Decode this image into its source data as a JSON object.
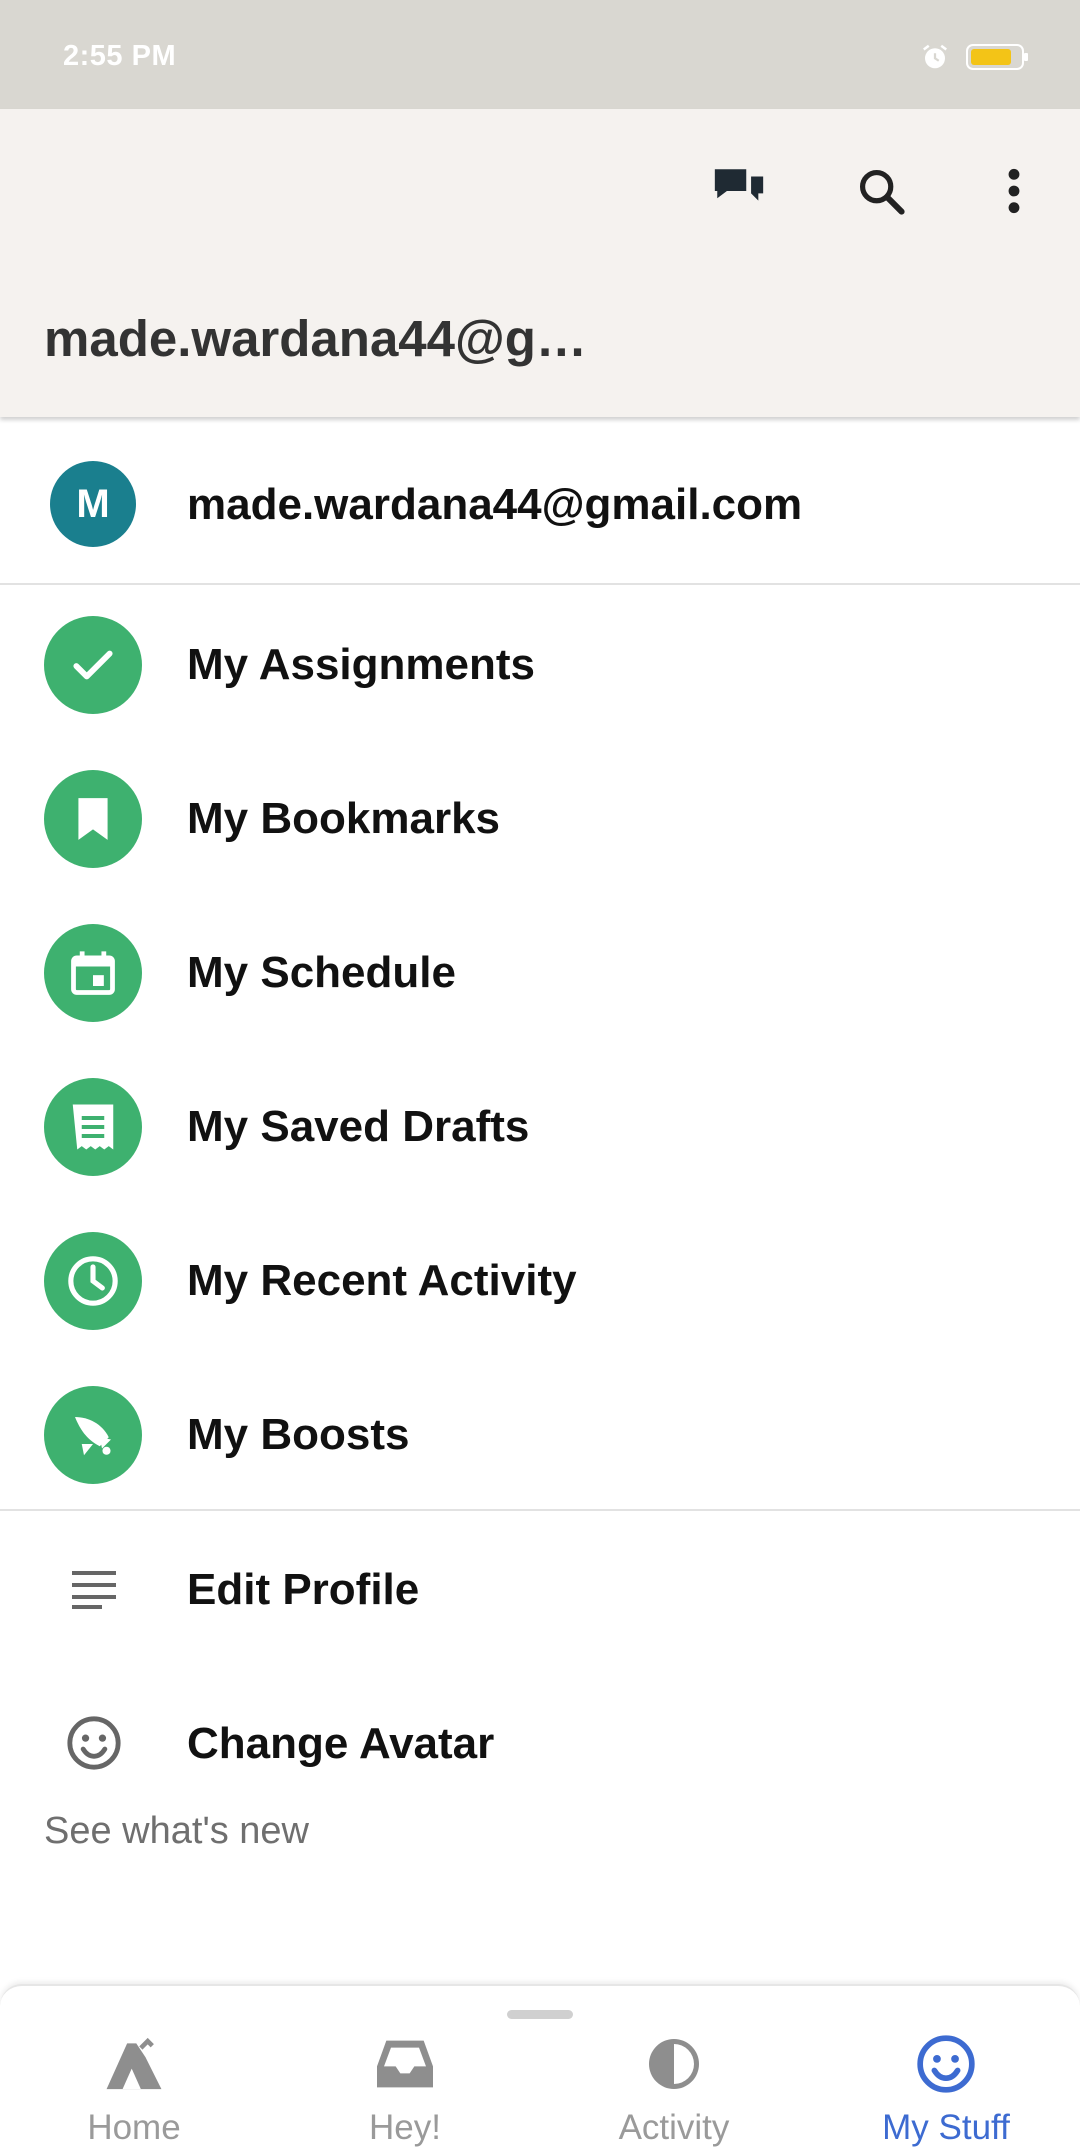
{
  "status_bar": {
    "time": "2:55 PM",
    "icons": [
      "alarm-icon",
      "battery-icon"
    ],
    "battery_color": "#f3c417"
  },
  "app_bar": {
    "title": "made.wardana44@g…",
    "actions": [
      "chat-icon",
      "search-icon",
      "more-vert-icon"
    ]
  },
  "account": {
    "avatar_letter": "M",
    "avatar_color": "#1a7f8e",
    "email": "made.wardana44@gmail.com"
  },
  "menu": {
    "accent": "#3eb16f",
    "items": [
      {
        "label": "My Assignments",
        "icon": "check-icon"
      },
      {
        "label": "My Bookmarks",
        "icon": "bookmark-icon"
      },
      {
        "label": "My Schedule",
        "icon": "calendar-icon"
      },
      {
        "label": "My Saved Drafts",
        "icon": "draft-icon"
      },
      {
        "label": "My Recent Activity",
        "icon": "clock-icon"
      },
      {
        "label": "My Boosts",
        "icon": "rocket-icon"
      }
    ]
  },
  "secondary": {
    "items": [
      {
        "label": "Edit Profile",
        "icon": "lines-icon"
      },
      {
        "label": "Change Avatar",
        "icon": "smiley-icon"
      }
    ],
    "whats_new": "See what's new"
  },
  "bottom_nav": {
    "active_color": "#3d6bd1",
    "tabs": [
      {
        "label": "Home",
        "icon": "home-icon"
      },
      {
        "label": "Hey!",
        "icon": "inbox-icon"
      },
      {
        "label": "Activity",
        "icon": "activity-icon"
      },
      {
        "label": "My Stuff",
        "icon": "smiley-icon",
        "active": true
      }
    ]
  }
}
